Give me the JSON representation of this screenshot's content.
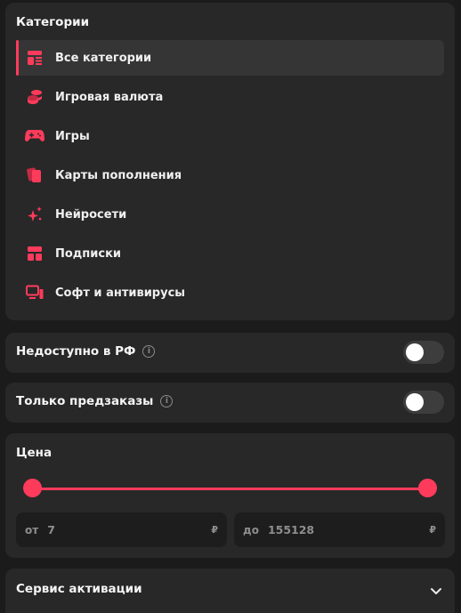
{
  "categories": {
    "title": "Категории",
    "items": [
      {
        "label": "Все категории",
        "icon": "list-icon",
        "active": true
      },
      {
        "label": "Игровая валюта",
        "icon": "coins-icon",
        "active": false
      },
      {
        "label": "Игры",
        "icon": "gamepad-icon",
        "active": false
      },
      {
        "label": "Карты пополнения",
        "icon": "cards-icon",
        "active": false
      },
      {
        "label": "Нейросети",
        "icon": "sparkles-icon",
        "active": false
      },
      {
        "label": "Подписки",
        "icon": "subscriptions-icon",
        "active": false
      },
      {
        "label": "Софт и антивирусы",
        "icon": "computer-icon",
        "active": false
      }
    ]
  },
  "filters": {
    "unavailable_rf": {
      "label": "Недоступно в РФ",
      "enabled": false
    },
    "preorders_only": {
      "label": "Только предзаказы",
      "enabled": false
    }
  },
  "price": {
    "title": "Цена",
    "from_prefix": "от",
    "from_value": "7",
    "to_prefix": "до",
    "to_value": "155128",
    "currency": "₽",
    "range_fraction": [
      0,
      1
    ]
  },
  "activation": {
    "label": "Сервис активации"
  },
  "colors": {
    "accent": "#ff3b5c",
    "card": "#282828",
    "background": "#1b1b1b"
  }
}
